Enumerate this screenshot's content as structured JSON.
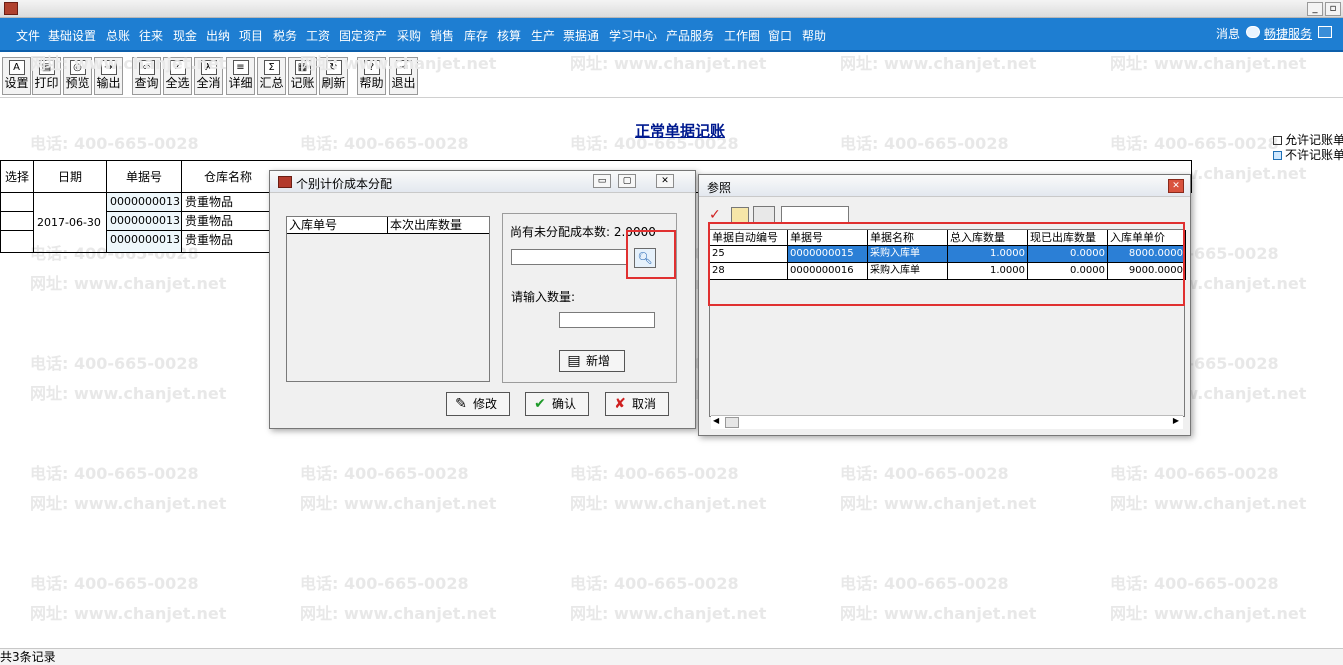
{
  "menubar": {
    "items": [
      "文件",
      "基础设置",
      "总账",
      "往来",
      "现金",
      "出纳",
      "项目",
      "税务",
      "工资",
      "固定资产",
      "采购",
      "销售",
      "库存",
      "核算",
      "生产",
      "票据通",
      "学习中心",
      "产品服务",
      "工作圈",
      "窗口",
      "帮助"
    ],
    "message": "消息",
    "quick_service": "畅捷服务"
  },
  "toolbar": {
    "buttons": [
      {
        "label": "设置",
        "icon": "settings-icon",
        "glyph": "A"
      },
      {
        "label": "打印",
        "icon": "print-icon",
        "glyph": "▤"
      },
      {
        "label": "预览",
        "icon": "preview-icon",
        "glyph": "◎"
      },
      {
        "label": "输出",
        "icon": "export-icon",
        "glyph": "→"
      },
      {
        "label": "查询",
        "icon": "binoculars-icon",
        "glyph": "∞"
      },
      {
        "label": "全选",
        "icon": "select-all-icon",
        "glyph": "✓"
      },
      {
        "label": "全消",
        "icon": "deselect-all-icon",
        "glyph": "✗"
      },
      {
        "label": "详细",
        "icon": "detail-icon",
        "glyph": "≡"
      },
      {
        "label": "汇总",
        "icon": "summary-icon",
        "glyph": "Σ"
      },
      {
        "label": "记账",
        "icon": "bookkeeping-icon",
        "glyph": "▦"
      },
      {
        "label": "刷新",
        "icon": "refresh-icon",
        "glyph": "↻"
      },
      {
        "label": "帮助",
        "icon": "help-icon",
        "glyph": "?"
      },
      {
        "label": "退出",
        "icon": "exit-icon",
        "glyph": "⇥"
      }
    ]
  },
  "watermark": {
    "phone": "电话: 400-665-0028",
    "site": "网址: www.chanjet.net"
  },
  "page": {
    "title": "正常单据记账"
  },
  "legend": {
    "allow": "允许记账单",
    "deny": "不许记账单"
  },
  "grid": {
    "headers": [
      "选择",
      "日期",
      "单据号",
      "仓库名称"
    ],
    "date": "2017-06-30",
    "rows": [
      {
        "doc_no": "0000000013",
        "warehouse": "贵重物品"
      },
      {
        "doc_no": "0000000013",
        "warehouse": "贵重物品"
      },
      {
        "doc_no": "0000000013",
        "warehouse": "贵重物品"
      }
    ]
  },
  "dialog_alloc": {
    "title": "个别计价成本分配",
    "col_in_no": "入库单号",
    "col_out_qty": "本次出库数量",
    "remaining_label": "尚有未分配成本数: 2.0000",
    "qty_label": "请输入数量:",
    "add_button": "新增",
    "modify_button": "修改",
    "ok_button": "确认",
    "cancel_button": "取消"
  },
  "dialog_ref": {
    "title": "参照",
    "columns": [
      "单据自动编号",
      "单据号",
      "单据名称",
      "总入库数量",
      "现已出库数量",
      "入库单单价"
    ],
    "rows": [
      {
        "auto_no": "25",
        "doc_no": "0000000015",
        "doc_name": "采购入库单",
        "total_in": "1.0000",
        "out_qty": "0.0000",
        "unit_price": "8000.0000"
      },
      {
        "auto_no": "28",
        "doc_no": "0000000016",
        "doc_name": "采购入库单",
        "total_in": "1.0000",
        "out_qty": "0.0000",
        "unit_price": "9000.0000"
      }
    ]
  },
  "status": {
    "text": "共3条记录"
  },
  "colors": {
    "menubar": "#1e7ed2",
    "selection": "#2b7fd6",
    "highlight_box": "#e03030",
    "title_link": "#001a8f"
  }
}
